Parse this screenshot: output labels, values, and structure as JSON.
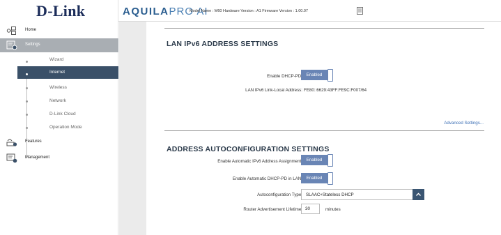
{
  "header": {
    "logo": "D-Link",
    "brand_main": "AQUILA",
    "brand_sub": "PRO AI",
    "model_info": "Model Name : M60 Hardware Version : A1 Firmware Version : 1.00.07",
    "doc_icon": "document-icon"
  },
  "sidebar": {
    "items": [
      {
        "label": "Home",
        "icon": "home-network-icon"
      },
      {
        "label": "Settings",
        "icon": "settings-icon",
        "active": true
      },
      {
        "label": "Features",
        "icon": "features-icon"
      },
      {
        "label": "Management",
        "icon": "management-icon"
      }
    ],
    "settings_sub": [
      {
        "label": "Wizard"
      },
      {
        "label": "Internet",
        "active": true
      },
      {
        "label": "Wireless"
      },
      {
        "label": "Network"
      },
      {
        "label": "D-Link Cloud"
      },
      {
        "label": "Operation Mode"
      }
    ]
  },
  "lan_section": {
    "title": "LAN IPv6 ADDRESS SETTINGS",
    "dhcp_pd_label": "Enable DHCP-PD:",
    "dhcp_pd_value": "Enabled",
    "link_local_label": "LAN IPv6 Link-Local Address:",
    "link_local_value": "FE80::6629:43FF:FE9C:F007/64",
    "advanced_link": "Advanced Settings..."
  },
  "auto_section": {
    "title": "ADDRESS AUTOCONFIGURATION SETTINGS",
    "auto_assign_label": "Enable Automatic IPv6 Address Assignment:",
    "auto_assign_value": "Enabled",
    "auto_dhcp_pd_label": "Enable Automatic DHCP-PD in LAN:",
    "auto_dhcp_pd_value": "Enabled",
    "type_label": "Autoconfiguration Type:",
    "type_value": "SLAAC+Stateless DHCP",
    "lifetime_label": "Router Advertisement Lifetime:",
    "lifetime_value": "30",
    "lifetime_unit": "minutes"
  },
  "colors": {
    "toggle_on": "#6985b5",
    "active_sub": "#3a5068",
    "active_item": "#a9aeb3",
    "link": "#3c6fb5",
    "logo": "#1c2d5a"
  }
}
